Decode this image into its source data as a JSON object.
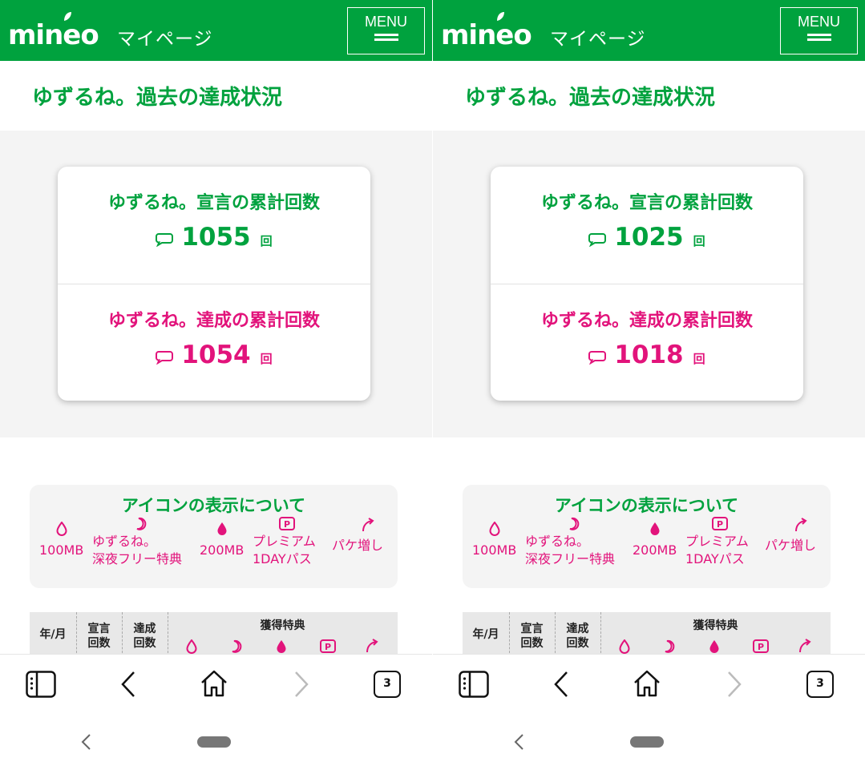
{
  "screens": [
    {
      "header": {
        "logo": "mineo",
        "subtitle": "マイページ",
        "menu_label": "MENU"
      },
      "page_title": "ゆずるね。過去の達成状況",
      "declared": {
        "label": "ゆずるね。宣言の累計回数",
        "count": "1055",
        "unit": "回"
      },
      "achieved": {
        "label": "ゆずるね。達成の累計回数",
        "count": "1054",
        "unit": "回"
      },
      "legend": {
        "title": "アイコンの表示について",
        "items": [
          {
            "icon": "drop-outline-icon",
            "lines": [
              "100MB"
            ]
          },
          {
            "icon": "moon-icon",
            "lines": [
              "ゆずるね。",
              "深夜フリー特典"
            ]
          },
          {
            "icon": "drop-filled-icon",
            "lines": [
              "200MB"
            ]
          },
          {
            "icon": "premium-p-icon",
            "lines": [
              "プレミアム",
              "1DAYパス"
            ]
          },
          {
            "icon": "arrow-up-icon",
            "lines": [
              "パケ増し"
            ]
          }
        ]
      },
      "table_head": {
        "month": "年/月",
        "declared": [
          "宣言",
          "回数"
        ],
        "achieved": [
          "達成",
          "回数"
        ],
        "benefits": "獲得特典"
      },
      "browser": {
        "tab_count": "3"
      }
    },
    {
      "header": {
        "logo": "mineo",
        "subtitle": "マイページ",
        "menu_label": "MENU"
      },
      "page_title": "ゆずるね。過去の達成状況",
      "declared": {
        "label": "ゆずるね。宣言の累計回数",
        "count": "1025",
        "unit": "回"
      },
      "achieved": {
        "label": "ゆずるね。達成の累計回数",
        "count": "1018",
        "unit": "回"
      },
      "legend": {
        "title": "アイコンの表示について",
        "items": [
          {
            "icon": "drop-outline-icon",
            "lines": [
              "100MB"
            ]
          },
          {
            "icon": "moon-icon",
            "lines": [
              "ゆずるね。",
              "深夜フリー特典"
            ]
          },
          {
            "icon": "drop-filled-icon",
            "lines": [
              "200MB"
            ]
          },
          {
            "icon": "premium-p-icon",
            "lines": [
              "プレミアム",
              "1DAYパス"
            ]
          },
          {
            "icon": "arrow-up-icon",
            "lines": [
              "パケ増し"
            ]
          }
        ]
      },
      "table_head": {
        "month": "年/月",
        "declared": [
          "宣言",
          "回数"
        ],
        "achieved": [
          "達成",
          "回数"
        ],
        "benefits": "獲得特典"
      },
      "browser": {
        "tab_count": "3"
      }
    }
  ],
  "colors": {
    "brand_green": "#00a23e",
    "accent_pink": "#e2137b"
  }
}
